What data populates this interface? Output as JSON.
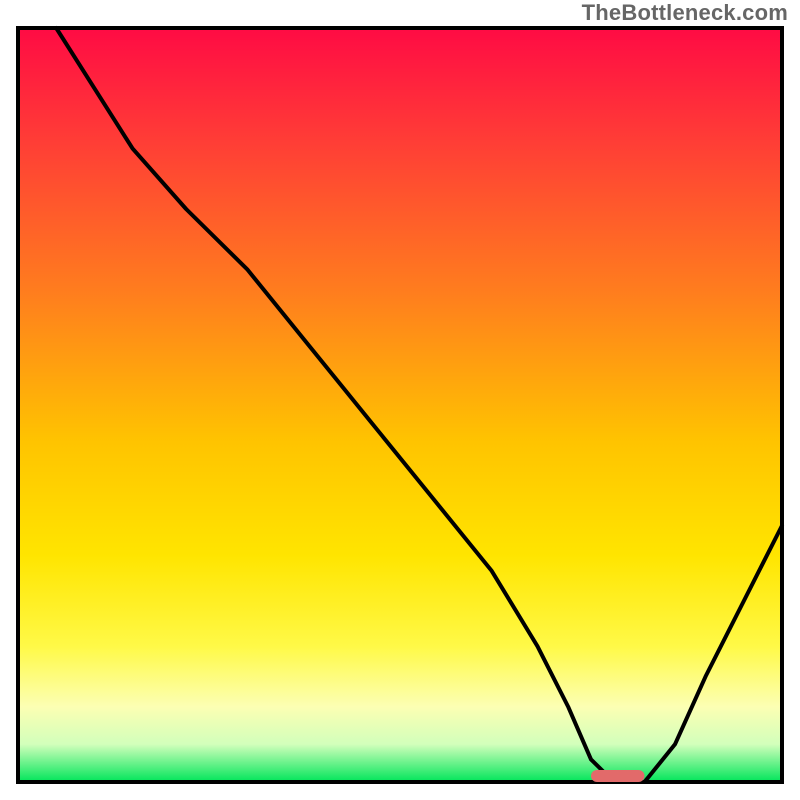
{
  "watermark": "TheBottleneck.com",
  "chart_data": {
    "type": "line",
    "title": "",
    "xlabel": "",
    "ylabel": "",
    "xlim": [
      0,
      100
    ],
    "ylim": [
      0,
      100
    ],
    "grid": false,
    "legend": false,
    "gradient_stops": [
      {
        "offset": 0,
        "color": "#ff0b44"
      },
      {
        "offset": 15,
        "color": "#ff3d36"
      },
      {
        "offset": 35,
        "color": "#ff7d1e"
      },
      {
        "offset": 55,
        "color": "#ffc400"
      },
      {
        "offset": 70,
        "color": "#ffe500"
      },
      {
        "offset": 82,
        "color": "#fff947"
      },
      {
        "offset": 90,
        "color": "#fcffb3"
      },
      {
        "offset": 95,
        "color": "#d2ffbb"
      },
      {
        "offset": 100,
        "color": "#00e55a"
      }
    ],
    "series": [
      {
        "name": "bottleneck-curve",
        "color": "#000000",
        "x": [
          5,
          10,
          15,
          22,
          30,
          38,
          46,
          54,
          62,
          68,
          72,
          75,
          78,
          82,
          86,
          90,
          95,
          100
        ],
        "y": [
          100,
          92,
          84,
          76,
          68,
          58,
          48,
          38,
          28,
          18,
          10,
          3,
          0,
          0,
          5,
          14,
          24,
          34
        ]
      }
    ],
    "optimal_marker": {
      "x_start": 75,
      "x_end": 82,
      "color": "#e26a6a",
      "thickness": 12
    }
  }
}
